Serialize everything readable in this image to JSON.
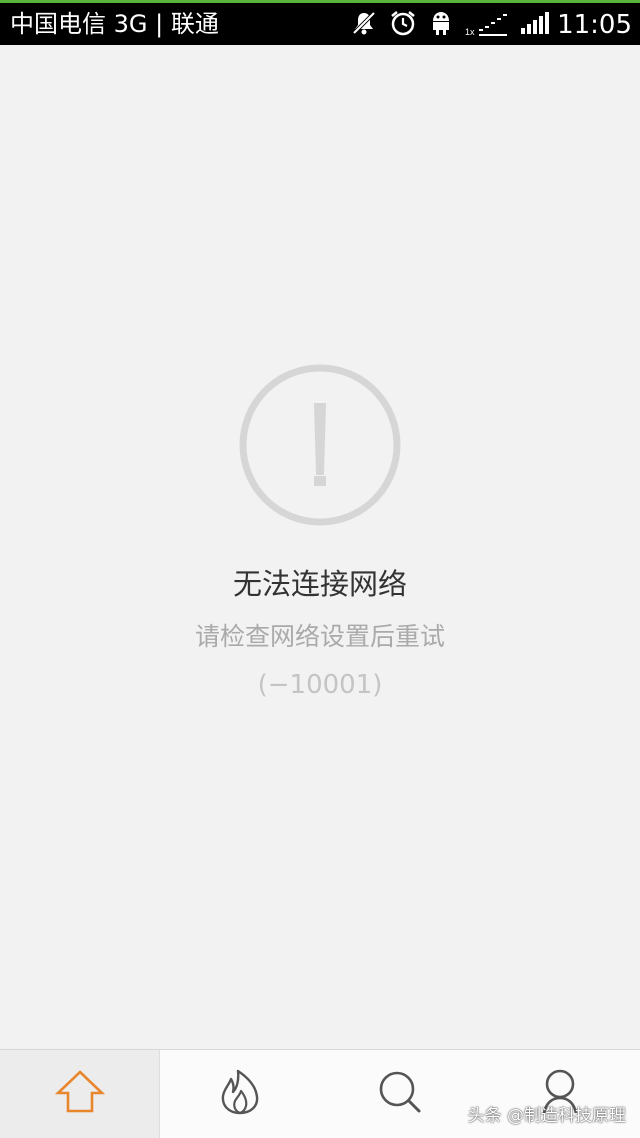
{
  "status_bar": {
    "carrier": "中国电信 3G | 联通",
    "time": "11:05",
    "icons": [
      "mute-icon",
      "alarm-icon",
      "usb-debug-icon",
      "data-signal-icon",
      "signal-icon"
    ],
    "data_type_label": "1x"
  },
  "error": {
    "icon": "alert-circle-icon",
    "title": "无法连接网络",
    "message": "请检查网络设置后重试",
    "code": "(−10001)"
  },
  "tab_bar": {
    "tabs": [
      {
        "icon": "home-icon",
        "active": true
      },
      {
        "icon": "hot-icon",
        "active": false
      },
      {
        "icon": "search-icon",
        "active": false
      },
      {
        "icon": "profile-icon",
        "active": false
      }
    ],
    "active_color": "#e8862b",
    "inactive_color": "#555555"
  },
  "watermark": "头条 @制造科技原理"
}
